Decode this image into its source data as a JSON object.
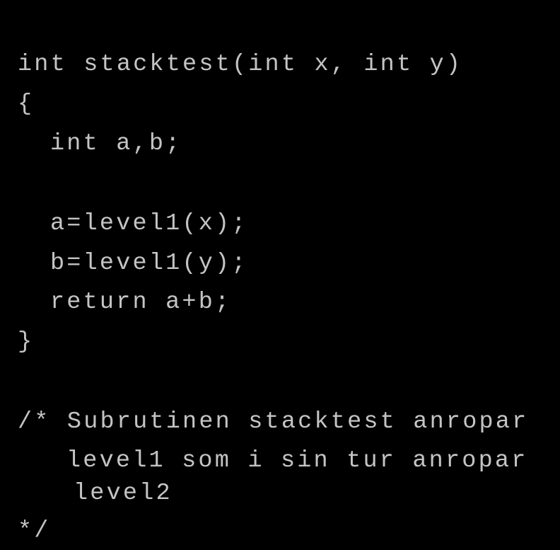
{
  "theme": {
    "background": "#000000",
    "text_color": "#c4c4c4"
  },
  "code": {
    "lines": [
      "int stacktest(int x, int y)",
      "{",
      "int a,b;",
      "a=level1(x);",
      "b=level1(y);",
      "return a+b;",
      "}",
      "/* Subrutinen stacktest anropar",
      "level1 som i sin tur anropar",
      "level2",
      "*/"
    ]
  }
}
